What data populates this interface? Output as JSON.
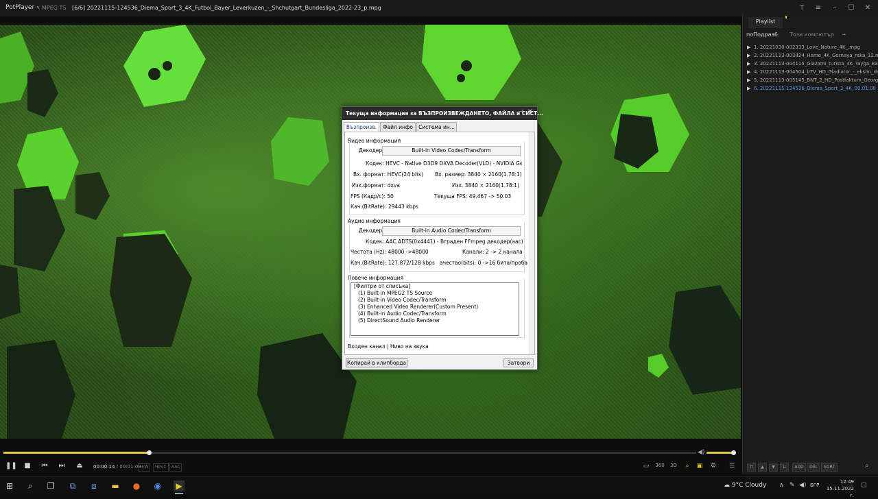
{
  "app": {
    "name": "PotPlayer",
    "format": "MPEG TS",
    "title": "[6/6] 20221115-124536_Diema_Sport_3_4K_Futbol_Bayer_Leverkuzen_-_Shchutgart_Bundesliga_2022-23_p.mpg"
  },
  "playlist": {
    "tab": "Playlist",
    "subtabs": [
      "поПодраз6.",
      "Този компютър",
      "+"
    ],
    "items": [
      {
        "label": "1. 20221030-002333_Love_Nature_4K_.mpg",
        "duration": ""
      },
      {
        "label": "2. 20221113-003824_Home_4K_Gornaya_reka_12.mpg",
        "duration": ""
      },
      {
        "label": "3. 20221113-004115_Glazami_turista_4K_Tayga_Ban...",
        "duration": ""
      },
      {
        "label": "4. 20221113-004504_bTV_HD_Gladiator_-_ekshn_dra...",
        "duration": ""
      },
      {
        "label": "5. 20221113-005145_BNT_2_HD_Postfaktum_Georgi_...",
        "duration": ""
      },
      {
        "label": "6. 20221115-124536_Diema_Sport_3_4K_Fu...",
        "duration": "00:01:08"
      }
    ],
    "buttons": [
      "ADD",
      "DEL",
      "SORT"
    ]
  },
  "player": {
    "time_current": "00:00:14",
    "time_separator": "/",
    "time_total": "00:01:08",
    "tags": [
      "H/W",
      "HEVC",
      "AAC"
    ],
    "progress": 0.21,
    "volume": 1.0,
    "accent": "#e2c63a"
  },
  "dialog": {
    "title": "Текуща информация за ВЪЗПРОИЗВЕЖДАНЕТО, ФАЙЛА и СИСТ...",
    "tabs": [
      "Възпроизв.",
      "Файл инфо",
      "Система ин..."
    ],
    "video": {
      "header": "Видео информация",
      "decoder_label": "Декодер:",
      "decoder": "Built-in Video Codec/Transform",
      "codec": "Кодек: HEVC - Native D3D9 DXVA Decoder(VLD) - NVIDIA GeForce G",
      "in_format": "Вх. формат: HEVC(24 bits)",
      "in_size": "Вх. размер: 3840 × 2160(1.78:1)",
      "out_format": "Изх.формат: dxva",
      "out_size": "Изх. 3840 × 2160(1.78:1)",
      "fps": "FPS (Кадр/с): 50",
      "cur_fps": "Текуща FPS: 49.467 -> 50.03",
      "bitrate": "Кач.(BitRate): 29443 kbps"
    },
    "audio": {
      "header": "Аудио информация",
      "decoder_label": "Декодер:",
      "decoder": "Built-in Audio Codec/Transform",
      "codec": "Кодек: AAC ADTS(0x4441) - Вграден FFmpeg декодер(aac)",
      "freq": "Честота (Hz): 48000 ->48000",
      "channels": "Канали: 2 -> 2 канала",
      "bitrate": "Кач.(BitRate): 127.872/128 kbps",
      "bits": "ачество(bits): 0 ->16 бита/проба"
    },
    "more": {
      "header": "Повече информация",
      "lines": [
        "[Филтри от списъка]",
        "(1) Built-in MPEG2 TS Source",
        "(2) Built-in Video Codec/Transform",
        "(3) Enhanced Video Renderer(Custom Present)",
        "(4) Built-in Audio Codec/Transform",
        "(5) DirectSound Audio Renderer"
      ]
    },
    "input_header": "Входен канал | Ниво на звука",
    "copy_button": "Копирай в клипборда",
    "close_button": "Затвори"
  },
  "taskbar": {
    "weather": "9°C  Cloudy",
    "lang": "БГР",
    "time": "12:49",
    "date": "15.11.2022 г."
  }
}
